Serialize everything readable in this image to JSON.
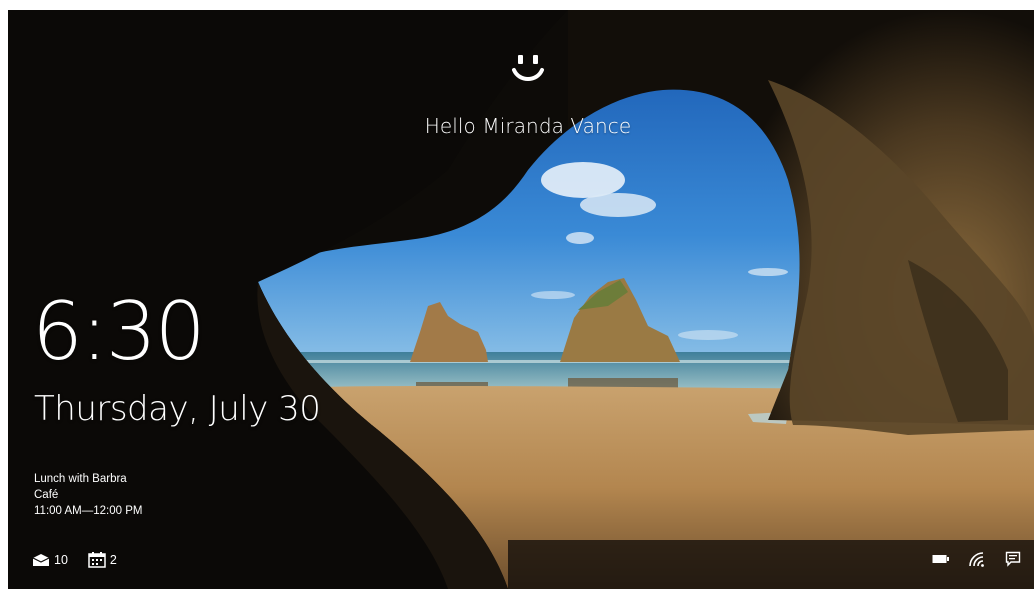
{
  "lock_screen": {
    "greeting": "Hello Miranda Vance",
    "time": "6:30",
    "date": "Thursday, July 30",
    "event": {
      "title": "Lunch with Barbra",
      "location": "Café",
      "time_range": "11:00 AM—12:00 PM"
    },
    "badges": {
      "mail_count": "10",
      "calendar_count": "2"
    },
    "icons": {
      "face": "windows-hello-face-icon",
      "mail": "mail-icon",
      "calendar": "calendar-icon",
      "battery": "battery-icon",
      "wifi": "wifi-icon",
      "notifications": "action-center-icon"
    },
    "colors": {
      "text": "#ffffff",
      "sky": "#2a74c4",
      "sand": "#b58a55",
      "cave": "#1a140d"
    }
  }
}
